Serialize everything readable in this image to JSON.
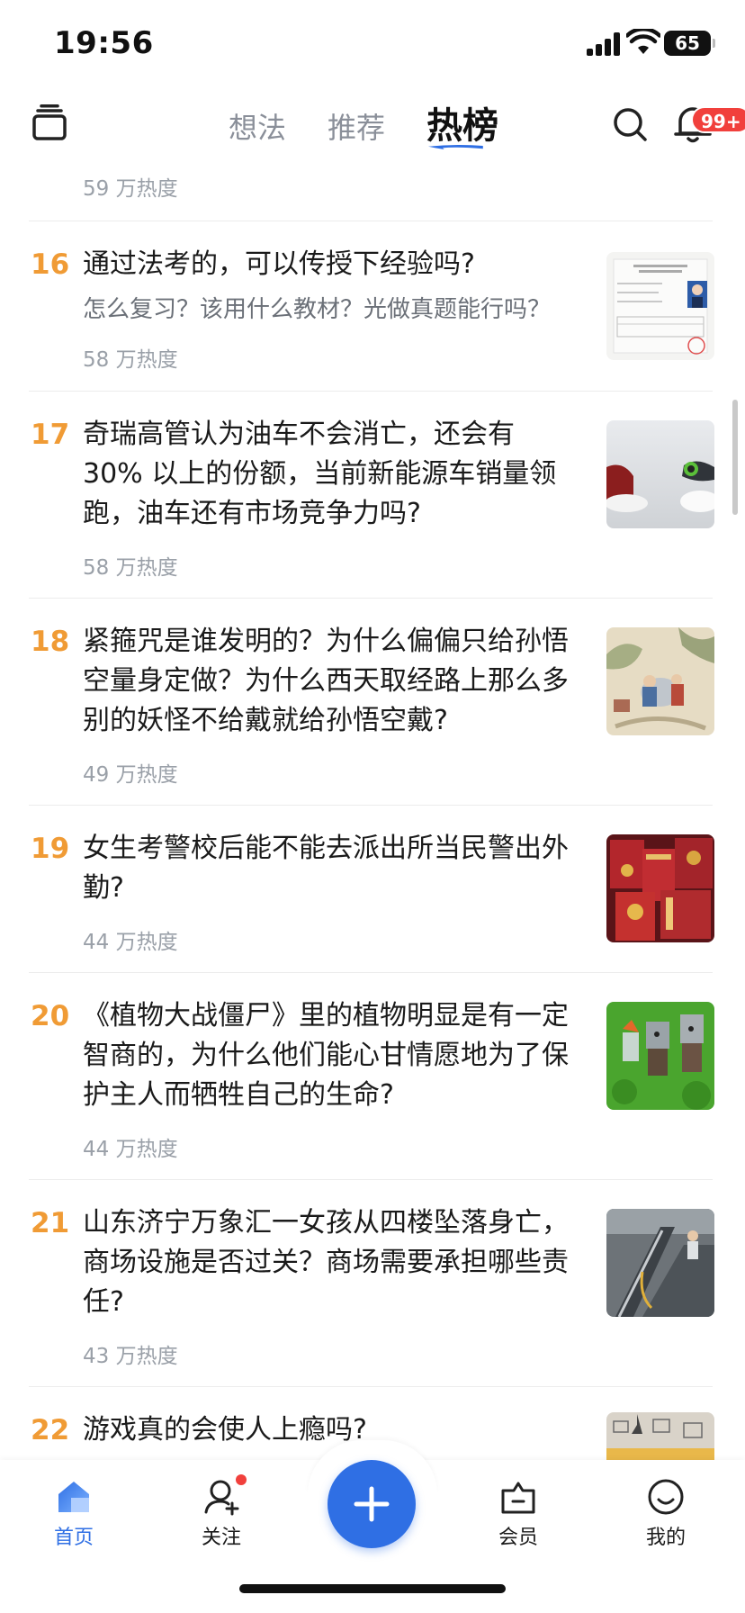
{
  "status_bar": {
    "time": "19:56",
    "battery": "65"
  },
  "header": {
    "tabs": [
      {
        "label": "想法",
        "active": false
      },
      {
        "label": "推荐",
        "active": false
      },
      {
        "label": "热榜",
        "active": true
      }
    ],
    "notification_badge": "99+"
  },
  "list": {
    "previous_heat": "59 万热度",
    "items": [
      {
        "rank": "16",
        "title": "通过法考的，可以传授下经验吗?",
        "excerpt": "怎么复习？该用什么教材？光做真题能行吗？",
        "heat": "58 万热度",
        "thumb_icon": "certificate-document-thumb"
      },
      {
        "rank": "17",
        "title": "奇瑞高管认为油车不会消亡，还会有 30% 以上的份额，当前新能源车销量领跑，油车还有市场竞争力吗?",
        "heat": "58 万热度",
        "thumb_icon": "fuel-nozzle-thumb"
      },
      {
        "rank": "18",
        "title": "紧箍咒是谁发明的？为什么偏偏只给孙悟空量身定做？为什么西天取经路上那么多别的妖怪不给戴就给孙悟空戴?",
        "heat": "49 万热度",
        "thumb_icon": "classical-painting-thumb"
      },
      {
        "rank": "19",
        "title": "女生考警校后能不能去派出所当民警出外勤?",
        "heat": "44 万热度",
        "thumb_icon": "honor-certificates-thumb"
      },
      {
        "rank": "20",
        "title": "《植物大战僵尸》里的植物明显是有一定智商的，为什么他们能心甘情愿地为了保护主人而牺牲自己的生命?",
        "heat": "44 万热度",
        "thumb_icon": "plants-vs-zombies-thumb"
      },
      {
        "rank": "21",
        "title": "山东济宁万象汇一女孩从四楼坠落身亡，商场设施是否过关？商场需要承担哪些责任?",
        "heat": "43 万热度",
        "thumb_icon": "mall-escalator-thumb"
      },
      {
        "rank": "22",
        "title": "游戏真的会使人上瘾吗?",
        "heat": "",
        "thumb_icon": "room-interior-thumb"
      }
    ]
  },
  "bottom_nav": {
    "items": [
      {
        "label": "首页",
        "icon": "home-icon",
        "active": true
      },
      {
        "label": "关注",
        "icon": "follow-icon",
        "active": false
      },
      {
        "label": "",
        "icon": "plus-icon",
        "active": false
      },
      {
        "label": "会员",
        "icon": "member-bag-icon",
        "active": false
      },
      {
        "label": "我的",
        "icon": "smile-icon",
        "active": false
      }
    ]
  },
  "colors": {
    "rank": "#f09b35",
    "accent": "#2f6fe4",
    "badge": "#f1403c",
    "muted": "#9aa0a8"
  }
}
